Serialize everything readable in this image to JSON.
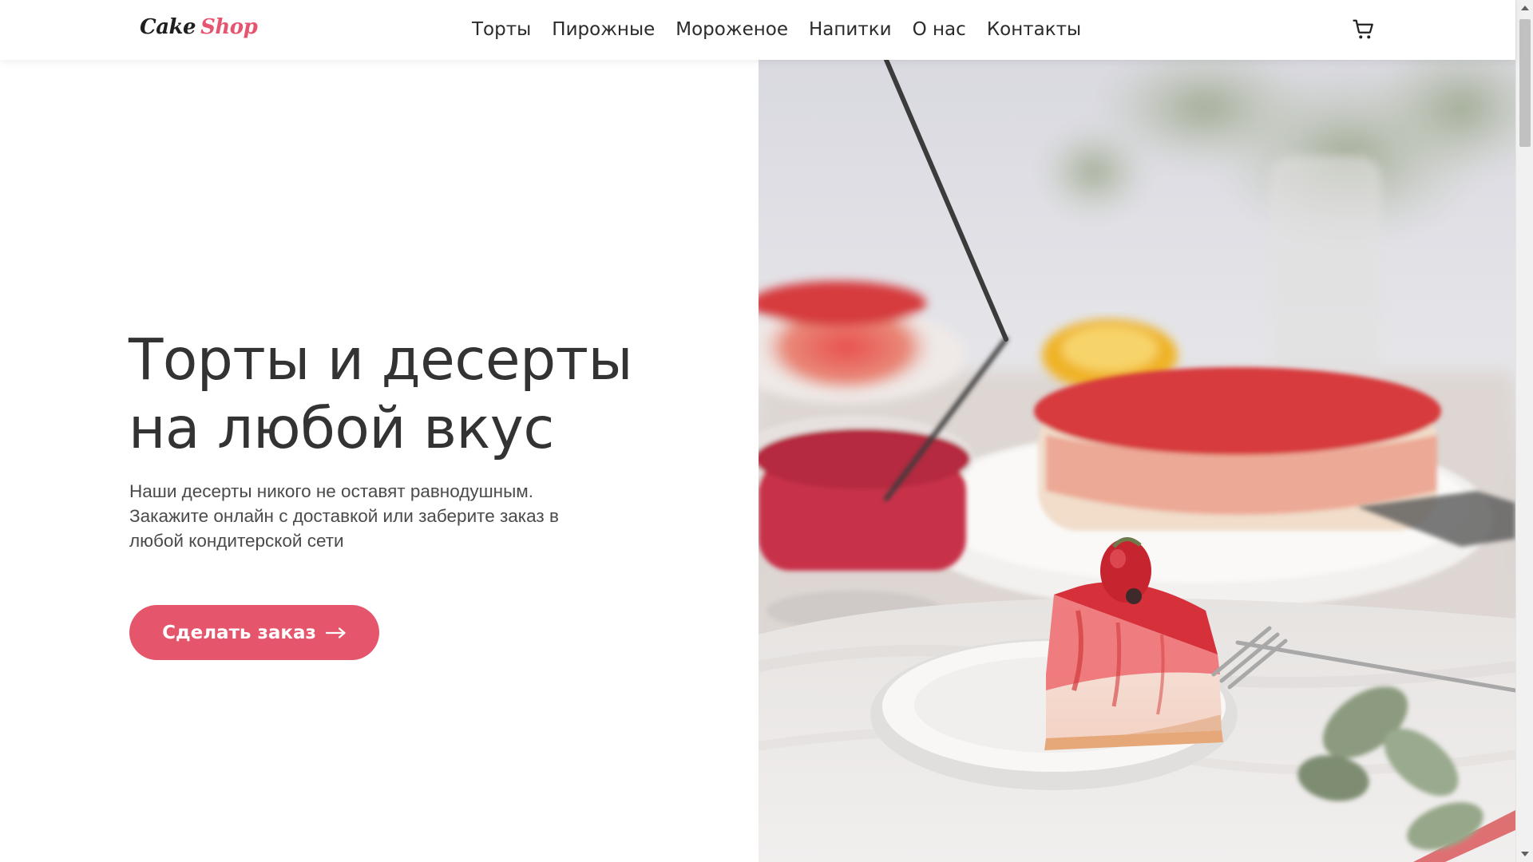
{
  "header": {
    "logo": {
      "word1": "Cake",
      "word2": "Shop"
    },
    "nav": [
      "Торты",
      "Пирожные",
      "Мороженое",
      "Напитки",
      "О нас",
      "Контакты"
    ],
    "cart_icon": "shopping-cart-icon"
  },
  "hero": {
    "title_line1": "Торты и десерты",
    "title_line2": "на любой вкус",
    "desc_line1": "Наши десерты никого не оставят равнодушным.",
    "desc_line2": "Закажите онлайн с доставкой или заберите заказ в",
    "desc_line3": "любой кондитерской сети",
    "cta_label": "Сделать заказ",
    "cta_icon": "arrow-right-icon"
  },
  "colors": {
    "accent": "#e5566d",
    "text": "#333333",
    "background": "#ffffff"
  }
}
